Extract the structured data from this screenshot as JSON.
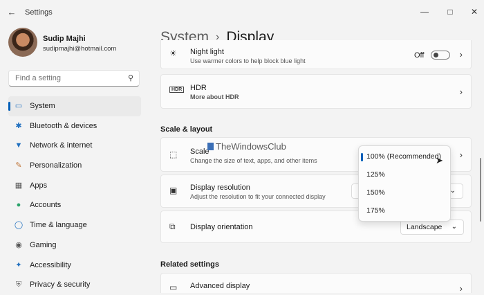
{
  "window": {
    "title": "Settings"
  },
  "profile": {
    "name": "Sudip Majhi",
    "email": "sudipmajhi@hotmail.com"
  },
  "search": {
    "placeholder": "Find a setting"
  },
  "nav": [
    {
      "label": "System",
      "icon": "monitor-icon",
      "selected": true
    },
    {
      "label": "Bluetooth & devices",
      "icon": "bluetooth-icon"
    },
    {
      "label": "Network & internet",
      "icon": "wifi-icon"
    },
    {
      "label": "Personalization",
      "icon": "brush-icon"
    },
    {
      "label": "Apps",
      "icon": "apps-icon"
    },
    {
      "label": "Accounts",
      "icon": "person-icon"
    },
    {
      "label": "Time & language",
      "icon": "globe-icon"
    },
    {
      "label": "Gaming",
      "icon": "gamepad-icon"
    },
    {
      "label": "Accessibility",
      "icon": "accessibility-icon"
    },
    {
      "label": "Privacy & security",
      "icon": "shield-icon"
    }
  ],
  "header": {
    "section": "System",
    "page": "Display"
  },
  "night_light": {
    "title": "Night light",
    "subtitle": "Use warmer colors to help block blue light",
    "state": "Off"
  },
  "hdr": {
    "title": "HDR",
    "link": "More about HDR",
    "icon_text": "HDR"
  },
  "scale_layout": {
    "heading": "Scale & layout"
  },
  "scale": {
    "title": "Scale",
    "subtitle": "Change the size of text, apps, and other items"
  },
  "resolution": {
    "title": "Display resolution",
    "subtitle": "Adjust the resolution to fit your connected display"
  },
  "orientation": {
    "title": "Display orientation",
    "value": "Landscape"
  },
  "scale_options": [
    "100% (Recommended)",
    "125%",
    "150%",
    "175%"
  ],
  "related": {
    "heading": "Related settings"
  },
  "advanced": {
    "title": "Advanced display"
  },
  "watermark": {
    "text": "TheWindowsClub"
  },
  "colors": {
    "accent": "#005fb8",
    "background": "#f3f3f3",
    "card": "#fbfbfb"
  }
}
